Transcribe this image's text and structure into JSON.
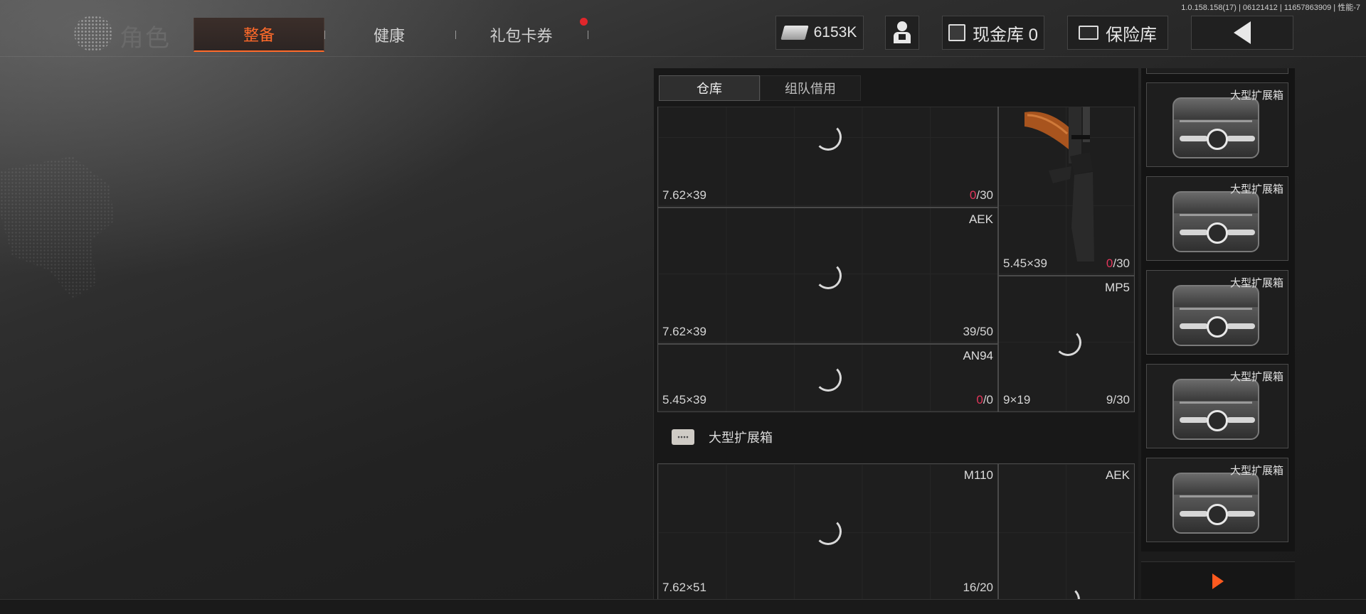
{
  "build_info": "1.0.158.158(17) | 06121412 | 11657863909 | 性能-7",
  "header": {
    "title": "角色",
    "tabs": [
      {
        "label": "整备",
        "active": true
      },
      {
        "label": "健康",
        "active": false
      },
      {
        "label": "礼包卡券",
        "active": false,
        "notification": true
      }
    ],
    "currency": {
      "value": "6153K",
      "icon": "cash-stack-icon"
    },
    "cash_vault": {
      "label": "现金库 0",
      "icon": "vault-icon"
    },
    "safe_box": {
      "label": "保险库",
      "icon": "safe-icon"
    },
    "back_icon": "chevron-left-icon",
    "accent_color": "#ff6a2a"
  },
  "inventory": {
    "subtabs": [
      {
        "label": "仓库",
        "active": true
      },
      {
        "label": "组队借用",
        "active": false
      }
    ],
    "grid1_items": [
      {
        "name": "",
        "ammo": "7.62×39",
        "cur": "0",
        "max": "/30",
        "zero": true
      },
      {
        "name": "AEK",
        "ammo": "7.62×39",
        "cur": "39",
        "max": "/50",
        "zero": false
      },
      {
        "name": "AN94",
        "ammo": "5.45×39",
        "cur": "0",
        "max": "/0",
        "zero": true
      },
      {
        "name": "",
        "ammo": "5.45×39",
        "cur": "0",
        "max": "/30",
        "zero": true
      },
      {
        "name": "MP5",
        "ammo": "9×19",
        "cur": "9",
        "max": "/30",
        "zero": false
      }
    ],
    "section": {
      "label": "大型扩展箱",
      "icon": "crate-icon"
    },
    "grid2_items": [
      {
        "name": "M110",
        "ammo": "7.62×51",
        "cur": "16",
        "max": "/20",
        "zero": false
      },
      {
        "name": "AEK",
        "ammo": "",
        "cur": "",
        "max": "",
        "zero": false
      }
    ]
  },
  "right_column": {
    "slots": [
      {
        "label": "大型扩展箱"
      },
      {
        "label": "大型扩展箱"
      },
      {
        "label": "大型扩展箱"
      },
      {
        "label": "大型扩展箱"
      },
      {
        "label": "大型扩展箱"
      }
    ],
    "next_icon": "play-arrow-icon"
  }
}
